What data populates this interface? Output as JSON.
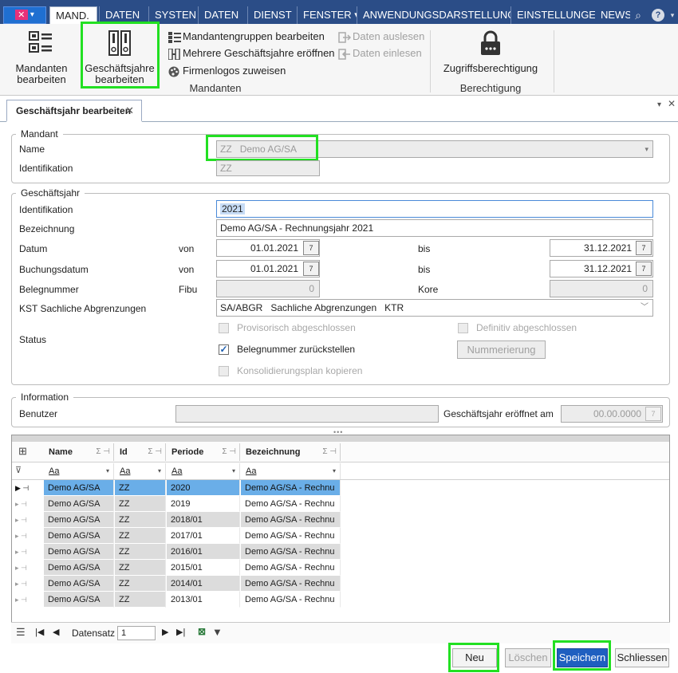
{
  "menu": {
    "tabs": [
      "MAND.",
      "DATEN",
      "SYSTEN",
      "DATEN",
      "DIENST",
      "FENSTER ▾",
      "ANWENDUNGSDARSTELLUNG ▾",
      "EINSTELLUNGEN",
      "NEWS"
    ]
  },
  "ribbon": {
    "mandanten_bearbeiten_1": "Mandanten",
    "mandanten_bearbeiten_2": "bearbeiten",
    "geschaeftsjahre_1": "Geschäftsjahre",
    "geschaeftsjahre_2": "bearbeiten",
    "mandantengruppen": "Mandantengruppen bearbeiten",
    "mehrere_jahre": "Mehrere Geschäftsjahre eröffnen",
    "firmenlogos": "Firmenlogos zuweisen",
    "daten_auslesen": "Daten auslesen",
    "daten_einlesen": "Daten einlesen",
    "group_mandanten": "Mandanten",
    "zugriff": "Zugriffsberechtigung",
    "group_berechtigung": "Berechtigung"
  },
  "doc_tab": {
    "label": "Geschäftsjahr bearbeiten",
    "close": "✕"
  },
  "mandant": {
    "legend": "Mandant",
    "name_label": "Name",
    "name_code": "ZZ",
    "name_value": "Demo AG/SA",
    "ident_label": "Identifikation",
    "ident_value": "ZZ"
  },
  "geschaeftsjahr": {
    "legend": "Geschäftsjahr",
    "ident_label": "Identifikation",
    "ident_value": "2021",
    "bez_label": "Bezeichnung",
    "bez_value": "Demo AG/SA - Rechnungsjahr 2021",
    "datum_label": "Datum",
    "von": "von",
    "bis": "bis",
    "datum_von": "01.01.2021",
    "datum_bis": "31.12.2021",
    "buchung_label": "Buchungsdatum",
    "buchung_von": "01.01.2021",
    "buchung_bis": "31.12.2021",
    "beleg_label": "Belegnummer",
    "fibu": "Fibu",
    "fibu_value": "0",
    "kore": "Kore",
    "kore_value": "0",
    "kst_label": "KST Sachliche Abgrenzungen",
    "kst_code": "SA/ABGR",
    "kst_text": "Sachliche Abgrenzungen",
    "kst_type": "KTR",
    "status_label": "Status",
    "prov": "Provisorisch abgeschlossen",
    "defin": "Definitiv abgeschlossen",
    "zurueck": "Belegnummer zurückstellen",
    "nummerierung": "Nummerierung",
    "konsol": "Konsolidierungsplan kopieren"
  },
  "information": {
    "legend": "Information",
    "benutzer_label": "Benutzer",
    "eroeffnet_label": "Geschäftsjahr eröffnet am",
    "eroeffnet_value": "00.00.0000"
  },
  "grid": {
    "columns": [
      "Name",
      "Id",
      "Periode",
      "Bezeichnung"
    ],
    "filter": "Aa",
    "rows": [
      [
        "Demo AG/SA",
        "ZZ",
        "2020",
        "Demo AG/SA - Rechnu"
      ],
      [
        "Demo AG/SA",
        "ZZ",
        "2019",
        "Demo AG/SA - Rechnu"
      ],
      [
        "Demo AG/SA",
        "ZZ",
        "2018/01",
        "Demo AG/SA - Rechnu"
      ],
      [
        "Demo AG/SA",
        "ZZ",
        "2017/01",
        "Demo AG/SA - Rechnu"
      ],
      [
        "Demo AG/SA",
        "ZZ",
        "2016/01",
        "Demo AG/SA - Rechnu"
      ],
      [
        "Demo AG/SA",
        "ZZ",
        "2015/01",
        "Demo AG/SA - Rechnu"
      ],
      [
        "Demo AG/SA",
        "ZZ",
        "2014/01",
        "Demo AG/SA - Rechnu"
      ],
      [
        "Demo AG/SA",
        "ZZ",
        "2013/01",
        "Demo AG/SA - Rechnu"
      ]
    ],
    "nav_label": "Datensatz",
    "nav_value": "1"
  },
  "buttons": {
    "neu": "Neu",
    "loeschen": "Löschen",
    "speichern": "Speichern",
    "schliessen": "Schliessen"
  },
  "colors": {
    "menubar": "#2b4d87",
    "highlight": "#22e022",
    "selection": "#6aaee8",
    "primary": "#1f5fc0"
  }
}
